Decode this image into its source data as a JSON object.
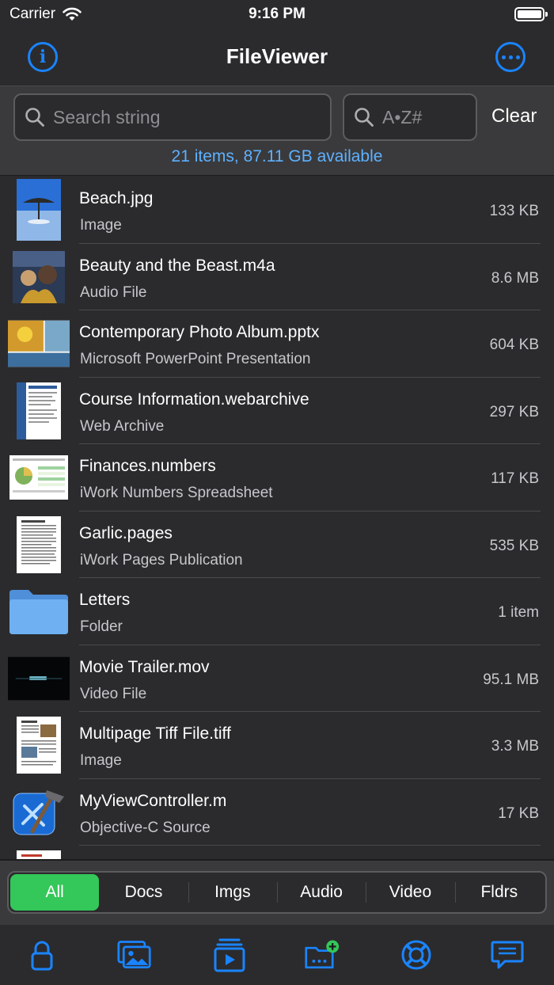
{
  "status": {
    "carrier": "Carrier",
    "time": "9:16 PM"
  },
  "nav": {
    "title": "FileViewer"
  },
  "search": {
    "placeholder": "Search string",
    "sort_placeholder": "A•Z#",
    "clear_label": "Clear",
    "summary": "21 items, 87.11 GB available"
  },
  "files": [
    {
      "name": "Beach.jpg",
      "type": "Image",
      "size": "133 KB",
      "icon": "beach-photo-thumbnail"
    },
    {
      "name": "Beauty and the Beast.m4a",
      "type": "Audio File",
      "size": "8.6 MB",
      "icon": "album-art-thumbnail"
    },
    {
      "name": "Contemporary Photo Album.pptx",
      "type": "Microsoft PowerPoint Presentation",
      "size": "604 KB",
      "icon": "presentation-thumbnail"
    },
    {
      "name": "Course Information.webarchive",
      "type": "Web Archive",
      "size": "297 KB",
      "icon": "webpage-thumbnail"
    },
    {
      "name": "Finances.numbers",
      "type": "iWork Numbers Spreadsheet",
      "size": "117 KB",
      "icon": "spreadsheet-thumbnail"
    },
    {
      "name": "Garlic.pages",
      "type": "iWork Pages Publication",
      "size": "535 KB",
      "icon": "document-thumbnail"
    },
    {
      "name": "Letters",
      "type": "Folder",
      "size": "1 item",
      "icon": "folder-icon"
    },
    {
      "name": "Movie Trailer.mov",
      "type": "Video File",
      "size": "95.1 MB",
      "icon": "video-thumbnail"
    },
    {
      "name": "Multipage Tiff File.tiff",
      "type": "Image",
      "size": "3.3 MB",
      "icon": "tiff-document-thumbnail"
    },
    {
      "name": "MyViewController.m",
      "type": "Objective-C Source",
      "size": "17 KB",
      "icon": "xcode-icon"
    }
  ],
  "filters": {
    "items": [
      "All",
      "Docs",
      "Imgs",
      "Audio",
      "Video",
      "Fldrs"
    ],
    "selected": "All"
  },
  "toolbar": {
    "icons": [
      "lock-icon",
      "photos-icon",
      "media-playlist-icon",
      "add-folder-icon",
      "help-lifebuoy-icon",
      "messages-icon"
    ]
  },
  "colors": {
    "accent": "#1a84ff",
    "selected_segment": "#34c759",
    "summary_text": "#5eb1ff",
    "background": "#2b2b2d"
  }
}
